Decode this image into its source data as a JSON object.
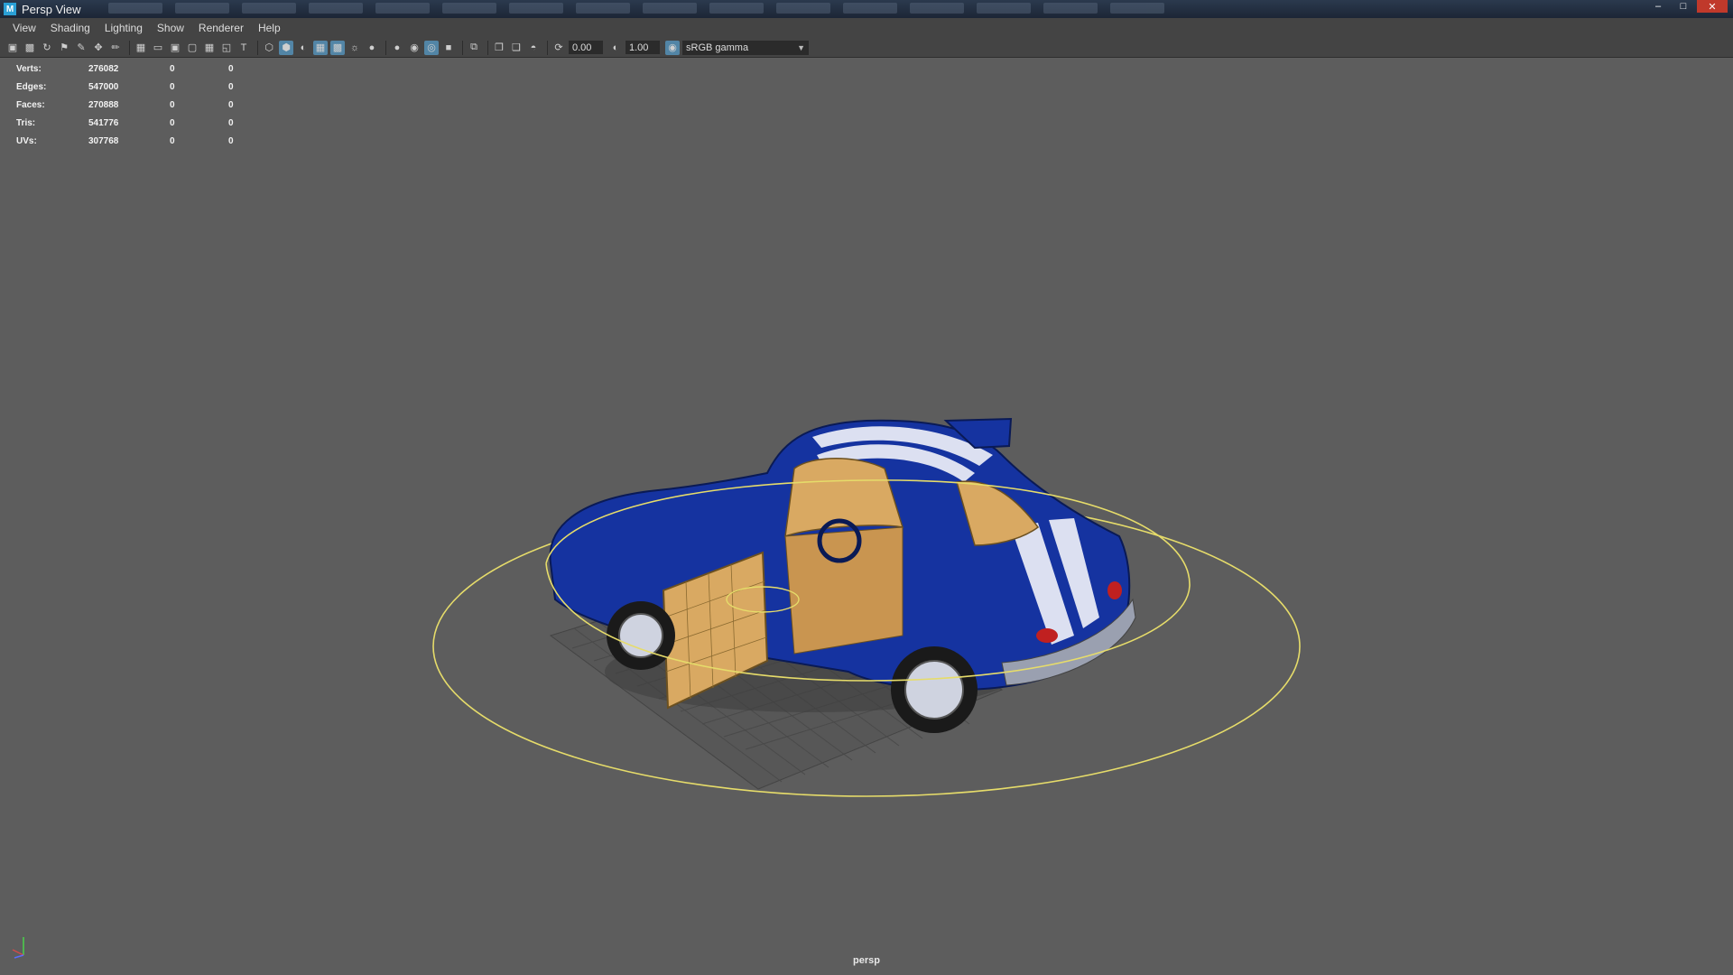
{
  "window": {
    "title": "Persp View"
  },
  "menu": [
    "View",
    "Shading",
    "Lighting",
    "Show",
    "Renderer",
    "Help"
  ],
  "toolbar": {
    "exposure_value": "0.00",
    "gamma_value": "1.00",
    "color_space": "sRGB gamma"
  },
  "hud": {
    "rows": [
      {
        "label": "Verts:",
        "v1": "276082",
        "v2": "0",
        "v3": "0"
      },
      {
        "label": "Edges:",
        "v1": "547000",
        "v2": "0",
        "v3": "0"
      },
      {
        "label": "Faces:",
        "v1": "270888",
        "v2": "0",
        "v3": "0"
      },
      {
        "label": "Tris:",
        "v1": "541776",
        "v2": "0",
        "v3": "0"
      },
      {
        "label": "UVs:",
        "v1": "307768",
        "v2": "0",
        "v3": "0"
      }
    ]
  },
  "viewport": {
    "camera_label": "persp"
  },
  "colors": {
    "background": "#5d5d5d",
    "car_body": "#1533a0",
    "interior": "#d9a962",
    "selection": "#e6dc6a"
  }
}
